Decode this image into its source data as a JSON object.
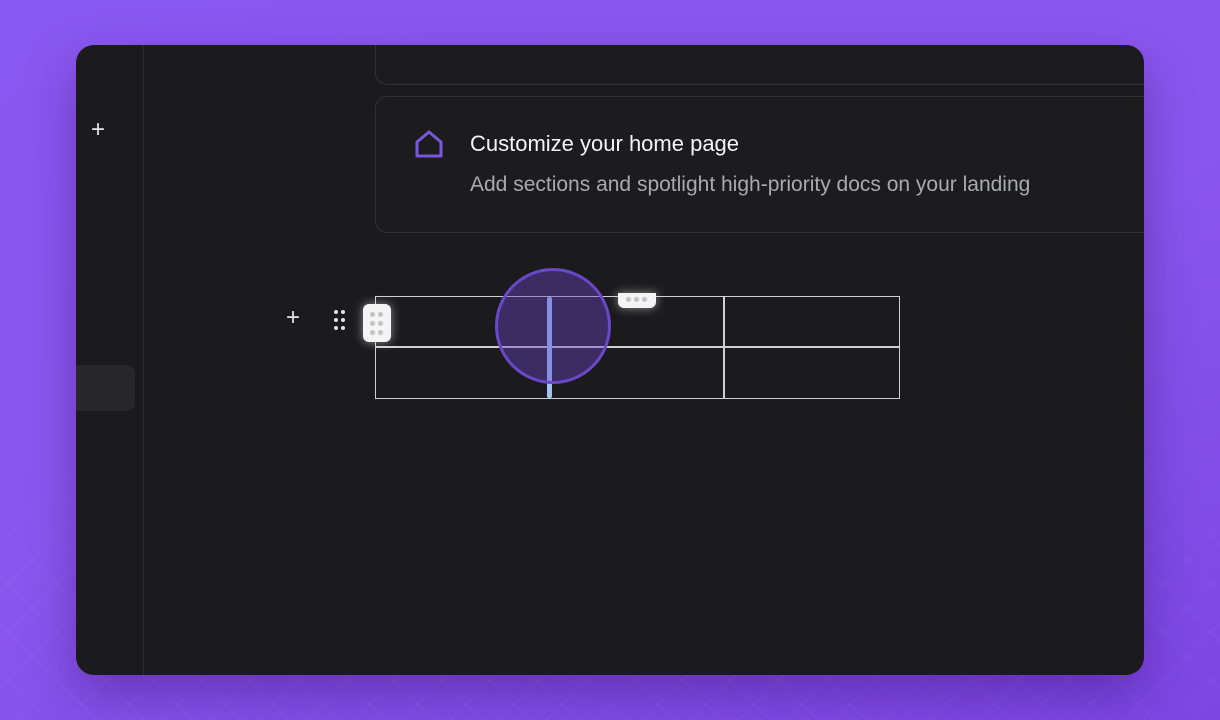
{
  "home_card": {
    "title": "Customize your home page",
    "description": "Add sections and spotlight high-priority docs on your landing"
  },
  "icons": {
    "sidebar_add": "+",
    "block_add": "+",
    "home": "home-icon",
    "drag_handle": "drag-handle-icon",
    "row_grip": "row-grip-icon",
    "column_grip": "column-options-icon"
  },
  "table": {
    "rows": 2,
    "columns": 3,
    "cells": [
      [
        "",
        "",
        ""
      ],
      [
        "",
        "",
        ""
      ]
    ]
  },
  "colors": {
    "accent": "#7a56d9",
    "resize_indicator": "#9ec3f7",
    "background": "#1b1b1d"
  }
}
